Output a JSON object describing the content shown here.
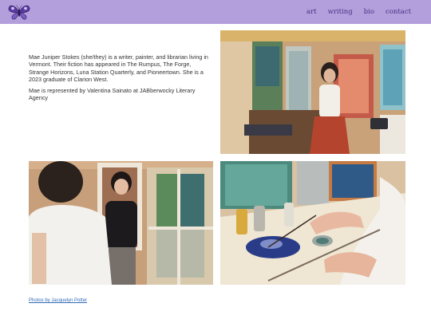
{
  "header": {
    "logo_icon": "moth-icon",
    "nav": [
      "art",
      "writing",
      "bio",
      "contact"
    ]
  },
  "bio": {
    "paragraph1": "Mae Juniper Stokes (she/they) is a writer, painter, and librarian living in Vermont. Their fiction has appeared in The Rumpus, The Forge, Strange Horizons, Luna Station Quarterly, and Pioneertown. She is a 2023 graduate of Clarion West.",
    "paragraph2": "Mae is represented by Valentina Sainato at JABberwocky Literary Agency"
  },
  "photos": [
    {
      "subject": "painter in studio with paintings"
    },
    {
      "subject": "painter laughing with friend"
    },
    {
      "subject": "hands painting with brush and paint palette"
    }
  ],
  "footer": {
    "credit": "Photos by Jacquelyn Potter"
  },
  "colors": {
    "header_bg": "#b29fdc",
    "nav_text": "#4a2f86",
    "credit_link": "#2f6ab7"
  }
}
